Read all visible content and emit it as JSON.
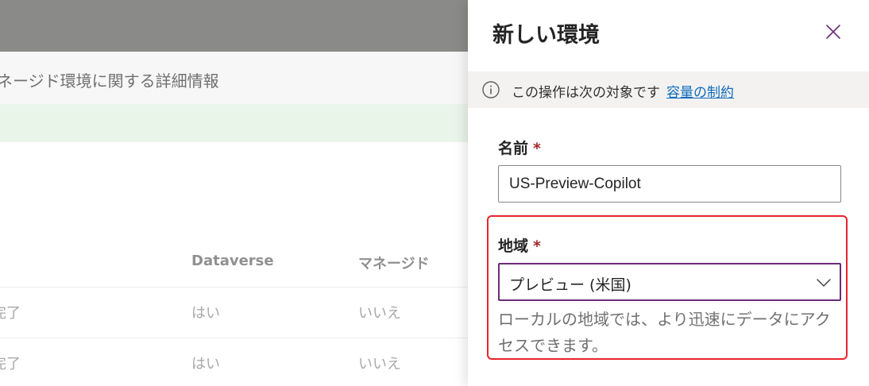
{
  "background": {
    "info_text": "ネージド環境に関する詳細情報",
    "columns": {
      "dataverse": "Dataverse",
      "managed": "マネージド"
    },
    "rows": [
      {
        "state": "完了",
        "dataverse": "はい",
        "managed": "いいえ"
      },
      {
        "state": "完了",
        "dataverse": "はい",
        "managed": "いいえ"
      }
    ]
  },
  "panel": {
    "title": "新しい環境",
    "close_icon": "close-icon",
    "info": {
      "icon": "info-icon",
      "text": "この操作は次の対象です",
      "link": "容量の制約"
    },
    "name": {
      "label": "名前",
      "required_marker": "*",
      "value": "US-Preview-Copilot"
    },
    "region": {
      "label": "地域",
      "required_marker": "*",
      "selected": "プレビュー (米国)",
      "help": "ローカルの地域では、より迅速にデータにアクセスできます。"
    }
  },
  "colors": {
    "accent": "#6b2c77",
    "link": "#0f6cbd",
    "required": "#a4262c",
    "highlight": "#e8242c"
  }
}
